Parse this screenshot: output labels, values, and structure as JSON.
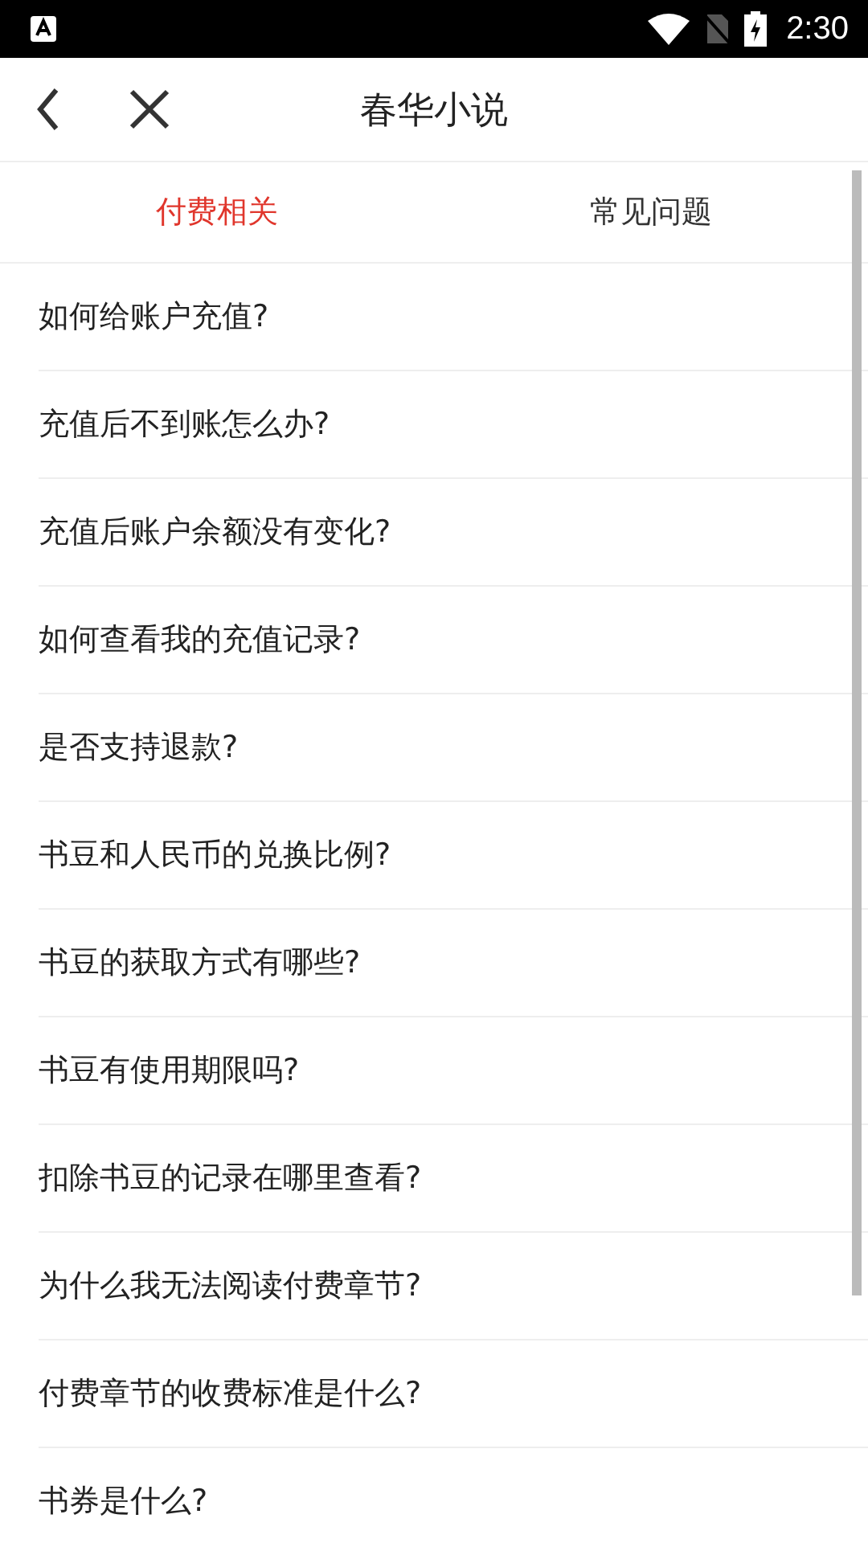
{
  "status_bar": {
    "time": "2:30"
  },
  "header": {
    "title": "春华小说"
  },
  "tabs": [
    {
      "label": "付费相关",
      "selected": true
    },
    {
      "label": "常见问题",
      "selected": false
    }
  ],
  "questions": [
    "如何给账户充值?",
    "充值后不到账怎么办?",
    "充值后账户余额没有变化?",
    "如何查看我的充值记录?",
    "是否支持退款?",
    "书豆和人民币的兑换比例?",
    "书豆的获取方式有哪些?",
    "书豆有使用期限吗?",
    "扣除书豆的记录在哪里查看?",
    "为什么我无法阅读付费章节?",
    "付费章节的收费标准是什么?",
    "书券是什么?"
  ]
}
